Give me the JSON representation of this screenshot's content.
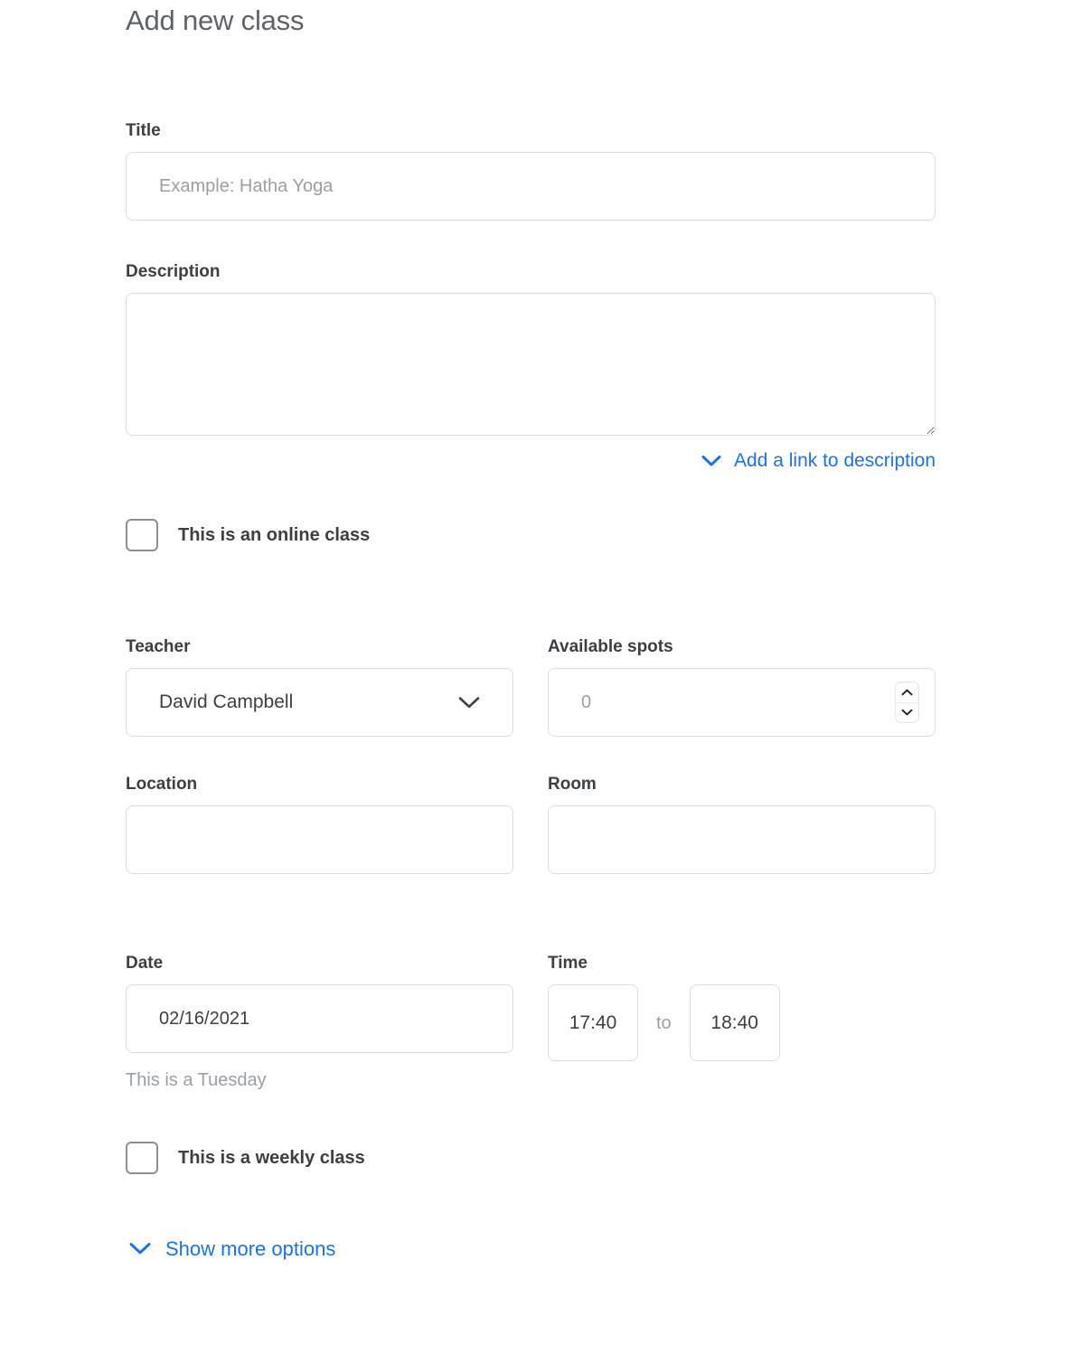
{
  "heading": "Add new class",
  "title_field": {
    "label": "Title",
    "placeholder": "Example: Hatha Yoga",
    "value": ""
  },
  "description_field": {
    "label": "Description",
    "placeholder": "",
    "value": ""
  },
  "description_link": {
    "label": "Add a link to description",
    "icon": "chevron-down-icon"
  },
  "online_checkbox": {
    "label": "This is an online class",
    "checked": false
  },
  "teacher_field": {
    "label": "Teacher",
    "value": "David Campbell",
    "icon": "chevron-down-icon",
    "options": [
      "David Campbell"
    ]
  },
  "spots_field": {
    "label": "Available spots",
    "placeholder": "0",
    "value": "",
    "increment_icon": "chevron-up-icon",
    "decrement_icon": "chevron-down-icon"
  },
  "location_field": {
    "label": "Location",
    "placeholder": "",
    "value": ""
  },
  "room_field": {
    "label": "Room",
    "placeholder": "",
    "value": ""
  },
  "date_field": {
    "label": "Date",
    "value": "02/16/2021",
    "helper": "This is a Tuesday"
  },
  "time_field": {
    "label": "Time",
    "start": "17:40",
    "separator": "to",
    "end": "18:40"
  },
  "weekly_checkbox": {
    "label": "This is a weekly class",
    "checked": false
  },
  "more_options_link": {
    "label": "Show more options",
    "icon": "chevron-down-icon"
  },
  "colors": {
    "accent": "#1a73e8",
    "text": "#3c4043",
    "muted": "#9aa0a6",
    "border": "#dadce0",
    "heading": "#5f6368"
  }
}
